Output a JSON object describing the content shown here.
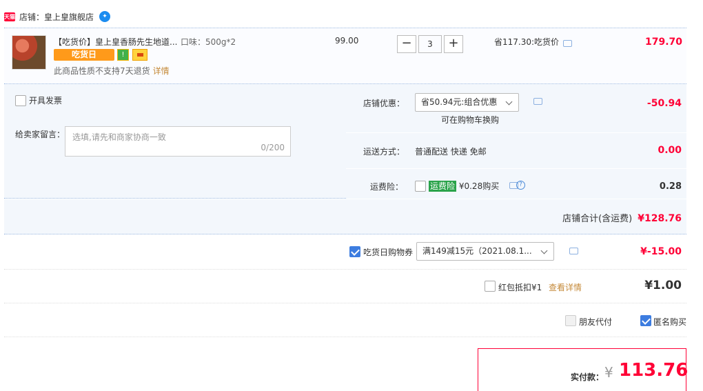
{
  "store": {
    "badge": "天猫",
    "name": "店铺：皇上皇旗舰店"
  },
  "item": {
    "title": "【吃货价】皇上皇香肠先生地道...",
    "spec": "口味：500g*2",
    "promo_tag": "吃货日",
    "notice": "此商品性质不支持7天退货",
    "notice_link": "详情",
    "unit_price": "99.00",
    "quantity": "3",
    "minus": "−",
    "plus": "+",
    "saving": "省117.30:吃货价",
    "subtotal": "179.70"
  },
  "options": {
    "invoice_label": "开具发票",
    "message_label": "给卖家留言：",
    "message_placeholder": "选填,请先和商家协商一致",
    "message_count": "0/200",
    "shop_discount_label": "店铺优惠：",
    "shop_discount_select": "省50.94元:组合优惠",
    "shop_discount_note": "可在购物车换购",
    "shop_discount_amount": "-50.94",
    "shipping_label": "运送方式：",
    "shipping_value": "普通配送 快递 免邮",
    "shipping_amount": "0.00",
    "insurance_label": "运费险：",
    "insurance_tag": "运费险",
    "insurance_price": "¥0.28购买",
    "insurance_amount": "0.28"
  },
  "shop_total": {
    "label": "店铺合计(含运费)",
    "value": "¥128.76"
  },
  "coupon": {
    "label": "吃货日购物券",
    "select": "满149减15元（2021.08.1...",
    "amount": "¥-15.00",
    "checked": true
  },
  "redpack": {
    "label": "红包抵扣¥1",
    "link": "查看详情",
    "amount": "¥1.00"
  },
  "friend_pay": {
    "label": "朋友代付"
  },
  "anonymous": {
    "label": "匿名购买"
  },
  "payment": {
    "label": "实付款：",
    "currency": "¥",
    "amount": "113.76"
  },
  "colors": {
    "accent_red": "#ff0036",
    "checkbox_blue": "#3d7de0",
    "row_bg": "#f3f7fc",
    "promo_orange": "#ff9a1a"
  },
  "icons": [
    "wangwang-chat-icon",
    "chat-bubble-icon",
    "help-icon",
    "chevron-down-icon",
    "check-icon"
  ]
}
